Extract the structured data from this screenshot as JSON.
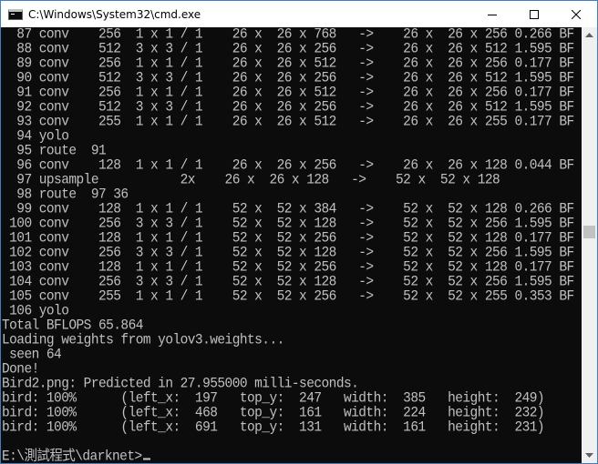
{
  "window": {
    "title": "C:\\Windows\\System32\\cmd.exe",
    "minimize_icon": "minimize-icon",
    "maximize_icon": "maximize-icon",
    "close_icon": "close-icon"
  },
  "console": {
    "lines": [
      "  87 conv    256  1 x 1 / 1    26 x  26 x 768   ->    26 x  26 x 256 0.266 BF",
      "  88 conv    512  3 x 3 / 1    26 x  26 x 256   ->    26 x  26 x 512 1.595 BF",
      "  89 conv    256  1 x 1 / 1    26 x  26 x 512   ->    26 x  26 x 256 0.177 BF",
      "  90 conv    512  3 x 3 / 1    26 x  26 x 256   ->    26 x  26 x 512 1.595 BF",
      "  91 conv    256  1 x 1 / 1    26 x  26 x 512   ->    26 x  26 x 256 0.177 BF",
      "  92 conv    512  3 x 3 / 1    26 x  26 x 256   ->    26 x  26 x 512 1.595 BF",
      "  93 conv    255  1 x 1 / 1    26 x  26 x 512   ->    26 x  26 x 255 0.177 BF",
      "  94 yolo",
      "  95 route  91",
      "  96 conv    128  1 x 1 / 1    26 x  26 x 256   ->    26 x  26 x 128 0.044 BF",
      "  97 upsample           2x    26 x  26 x 128   ->    52 x  52 x 128",
      "  98 route  97 36",
      "  99 conv    128  1 x 1 / 1    52 x  52 x 384   ->    52 x  52 x 128 0.266 BF",
      " 100 conv    256  3 x 3 / 1    52 x  52 x 128   ->    52 x  52 x 256 1.595 BF",
      " 101 conv    128  1 x 1 / 1    52 x  52 x 256   ->    52 x  52 x 128 0.177 BF",
      " 102 conv    256  3 x 3 / 1    52 x  52 x 128   ->    52 x  52 x 256 1.595 BF",
      " 103 conv    128  1 x 1 / 1    52 x  52 x 256   ->    52 x  52 x 128 0.177 BF",
      " 104 conv    256  3 x 3 / 1    52 x  52 x 128   ->    52 x  52 x 256 1.595 BF",
      " 105 conv    255  1 x 1 / 1    52 x  52 x 256   ->    52 x  52 x 255 0.353 BF",
      " 106 yolo",
      "Total BFLOPS 65.864",
      "Loading weights from yolov3.weights...",
      " seen 64",
      "Done!",
      "Bird2.png: Predicted in 27.955000 milli-seconds.",
      "bird: 100%      (left_x:  197   top_y:  247   width:  385   height:  249)",
      "bird: 100%      (left_x:  468   top_y:  161   width:  224   height:  232)",
      "bird: 100%      (left_x:  691   top_y:  131   width:  161   height:  231)",
      "",
      "E:\\測試程式\\darknet>"
    ]
  },
  "colors": {
    "background": "#0c0c0c",
    "text": "#c0c0c0",
    "titlebar": "#ffffff",
    "border": "#3b7fc4"
  }
}
